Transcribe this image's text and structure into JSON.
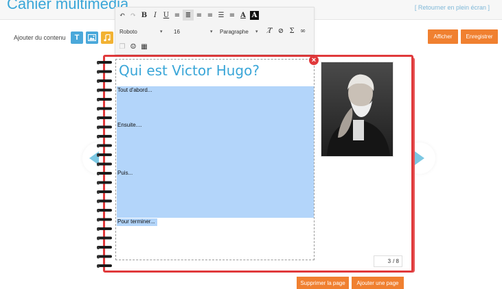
{
  "header": {
    "app_title": "Cahier multimédia",
    "top_right_link": "[ Retourner en plein écran ]"
  },
  "content_bar": {
    "add_label": "Ajouter du contenu",
    "tools": [
      {
        "name": "text",
        "label": "T",
        "color": "#4aa8da",
        "icon": "text-icon"
      },
      {
        "name": "image",
        "color": "#4aa8da",
        "icon": "image-icon"
      },
      {
        "name": "audio",
        "color": "#f2b233",
        "icon": "music-icon"
      }
    ]
  },
  "actions": {
    "show_label": "Afficher",
    "save_label": "Enregistrer",
    "delete_page_label": "Supprimer la page",
    "add_page_label": "Ajouter une page"
  },
  "editor_toolbar": {
    "font_family": "Roboto",
    "font_size": "16",
    "block_format": "Paragraphe",
    "icons_row1": [
      "undo-icon",
      "redo-icon",
      "bold-icon",
      "italic-icon",
      "underline-icon",
      "justify-icon",
      "align-center-icon",
      "align-left-icon",
      "align-right-icon",
      "bullet-list-icon",
      "numbered-list-icon",
      "text-color-icon",
      "background-color-icon"
    ],
    "icons_row2": [
      "clear-format-icon",
      "attachment-icon",
      "sigma-icon",
      "link-icon"
    ],
    "icons_row3": [
      "copy-icon",
      "emoji-icon",
      "table-icon"
    ]
  },
  "page": {
    "heading": "Qui est Victor Hugo?",
    "lines": [
      "Tout d'abord...",
      "Ensuite....",
      "Puis...",
      "Pour terminer..."
    ],
    "current_page": "3",
    "total_pages": "/ 8",
    "colors": {
      "border": "#e0393b",
      "heading": "#3aa6d8",
      "selection": "#b3d5fa",
      "accent": "#f08030"
    }
  }
}
